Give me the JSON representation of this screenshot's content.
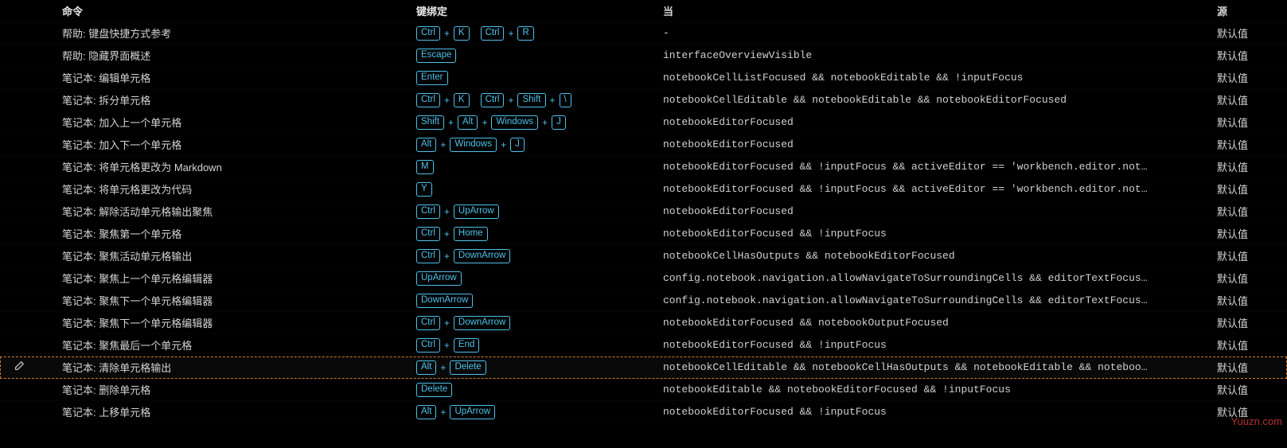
{
  "headers": {
    "command": "命令",
    "keybinding": "键绑定",
    "when": "当",
    "source": "源"
  },
  "default_source": "默认值",
  "watermark": "Yuuzn.com",
  "rows": [
    {
      "command": "帮助: 键盘快捷方式参考",
      "keys": [
        [
          "Ctrl",
          "K"
        ],
        [
          "Ctrl",
          "R"
        ]
      ],
      "when": "-",
      "selected": false,
      "hasEdit": false
    },
    {
      "command": "帮助: 隐藏界面概述",
      "keys": [
        [
          "Escape"
        ]
      ],
      "when": "interfaceOverviewVisible",
      "selected": false,
      "hasEdit": false
    },
    {
      "command": "笔记本: 编辑单元格",
      "keys": [
        [
          "Enter"
        ]
      ],
      "when": "notebookCellListFocused && notebookEditable && !inputFocus",
      "selected": false,
      "hasEdit": false
    },
    {
      "command": "笔记本: 拆分单元格",
      "keys": [
        [
          "Ctrl",
          "K"
        ],
        [
          "Ctrl",
          "Shift",
          "\\"
        ]
      ],
      "when": "notebookCellEditable && notebookEditable && notebookEditorFocused",
      "selected": false,
      "hasEdit": false
    },
    {
      "command": "笔记本: 加入上一个单元格",
      "keys": [
        [
          "Shift",
          "Alt",
          "Windows",
          "J"
        ]
      ],
      "when": "notebookEditorFocused",
      "selected": false,
      "hasEdit": false
    },
    {
      "command": "笔记本: 加入下一个单元格",
      "keys": [
        [
          "Alt",
          "Windows",
          "J"
        ]
      ],
      "when": "notebookEditorFocused",
      "selected": false,
      "hasEdit": false
    },
    {
      "command": "笔记本: 将单元格更改为 Markdown",
      "keys": [
        [
          "M"
        ]
      ],
      "when": "notebookEditorFocused && !inputFocus && activeEditor == 'workbench.editor.not…",
      "selected": false,
      "hasEdit": false
    },
    {
      "command": "笔记本: 将单元格更改为代码",
      "keys": [
        [
          "Y"
        ]
      ],
      "when": "notebookEditorFocused && !inputFocus && activeEditor == 'workbench.editor.not…",
      "selected": false,
      "hasEdit": false
    },
    {
      "command": "笔记本: 解除活动单元格输出聚焦",
      "keys": [
        [
          "Ctrl",
          "UpArrow"
        ]
      ],
      "when": "notebookEditorFocused",
      "selected": false,
      "hasEdit": false
    },
    {
      "command": "笔记本: 聚焦第一个单元格",
      "keys": [
        [
          "Ctrl",
          "Home"
        ]
      ],
      "when": "notebookEditorFocused && !inputFocus",
      "selected": false,
      "hasEdit": false
    },
    {
      "command": "笔记本: 聚焦活动单元格输出",
      "keys": [
        [
          "Ctrl",
          "DownArrow"
        ]
      ],
      "when": "notebookCellHasOutputs && notebookEditorFocused",
      "selected": false,
      "hasEdit": false
    },
    {
      "command": "笔记本: 聚焦上一个单元格编辑器",
      "keys": [
        [
          "UpArrow"
        ]
      ],
      "when": "config.notebook.navigation.allowNavigateToSurroundingCells && editorTextFocus…",
      "selected": false,
      "hasEdit": false
    },
    {
      "command": "笔记本: 聚焦下一个单元格编辑器",
      "keys": [
        [
          "DownArrow"
        ]
      ],
      "when": "config.notebook.navigation.allowNavigateToSurroundingCells && editorTextFocus…",
      "selected": false,
      "hasEdit": false
    },
    {
      "command": "笔记本: 聚焦下一个单元格编辑器",
      "keys": [
        [
          "Ctrl",
          "DownArrow"
        ]
      ],
      "when": "notebookEditorFocused && notebookOutputFocused",
      "selected": false,
      "hasEdit": false
    },
    {
      "command": "笔记本: 聚焦最后一个单元格",
      "keys": [
        [
          "Ctrl",
          "End"
        ]
      ],
      "when": "notebookEditorFocused && !inputFocus",
      "selected": false,
      "hasEdit": false
    },
    {
      "command": "笔记本: 清除单元格输出",
      "keys": [
        [
          "Alt",
          "Delete"
        ]
      ],
      "when": "notebookCellEditable && notebookCellHasOutputs && notebookEditable && noteboo…",
      "selected": true,
      "hasEdit": true
    },
    {
      "command": "笔记本: 删除单元格",
      "keys": [
        [
          "Delete"
        ]
      ],
      "when": "notebookEditable && notebookEditorFocused && !inputFocus",
      "selected": false,
      "hasEdit": false
    },
    {
      "command": "笔记本: 上移单元格",
      "keys": [
        [
          "Alt",
          "UpArrow"
        ]
      ],
      "when": "notebookEditorFocused && !inputFocus",
      "selected": false,
      "hasEdit": false
    }
  ]
}
